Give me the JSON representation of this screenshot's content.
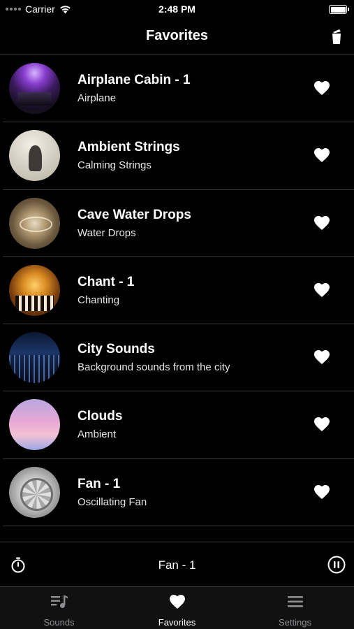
{
  "status_bar": {
    "carrier": "Carrier",
    "time": "2:48 PM"
  },
  "nav": {
    "title": "Favorites",
    "right_icon": "clear-icon"
  },
  "favorites": [
    {
      "title": "Airplane Cabin - 1",
      "subtitle": "Airplane"
    },
    {
      "title": "Ambient Strings",
      "subtitle": "Calming Strings"
    },
    {
      "title": "Cave Water Drops",
      "subtitle": "Water Drops"
    },
    {
      "title": "Chant - 1",
      "subtitle": "Chanting"
    },
    {
      "title": "City Sounds",
      "subtitle": "Background sounds from the city"
    },
    {
      "title": "Clouds",
      "subtitle": "Ambient"
    },
    {
      "title": "Fan - 1",
      "subtitle": "Oscillating Fan"
    }
  ],
  "now_playing": {
    "title": "Fan - 1",
    "left_icon": "timer-icon",
    "right_icon": "pause-icon"
  },
  "tabs": [
    {
      "label": "Sounds",
      "icon": "music-list-icon",
      "active": false
    },
    {
      "label": "Favorites",
      "icon": "heart-icon",
      "active": true
    },
    {
      "label": "Settings",
      "icon": "menu-icon",
      "active": false
    }
  ],
  "colors": {
    "background": "#000000",
    "separator": "#3a3a3c",
    "inactive_tab": "#8e8e93",
    "active_tab": "#ffffff"
  }
}
